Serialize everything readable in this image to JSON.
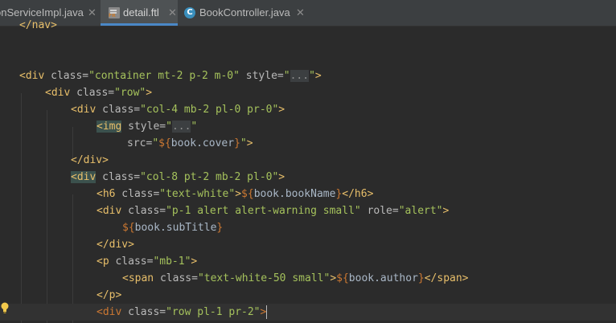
{
  "tabs": [
    {
      "label": "onServiceImpl.java",
      "active": false,
      "icon": "none"
    },
    {
      "label": "detail.ftl",
      "active": true,
      "icon": "ftl-file-icon"
    },
    {
      "label": "BookController.java",
      "active": false,
      "icon": "class-icon"
    }
  ],
  "close_glyph": "✕",
  "class_icon_letter": "C",
  "ftl_icon_letters": "FR",
  "editor": {
    "lines": [
      {
        "tokens": [
          {
            "t": "tag",
            "v": "</nav>"
          }
        ]
      },
      {
        "tokens": []
      },
      {
        "tokens": []
      },
      {
        "tokens": [
          {
            "t": "tag",
            "v": "<div"
          },
          {
            "t": "attr",
            "v": " class="
          },
          {
            "t": "str",
            "v": "\"container mt-2 p-2 m-0\""
          },
          {
            "t": "attr",
            "v": " style="
          },
          {
            "t": "str",
            "v": "\""
          },
          {
            "t": "fold",
            "v": "..."
          },
          {
            "t": "str",
            "v": "\""
          },
          {
            "t": "tag",
            "v": ">"
          }
        ]
      },
      {
        "tokens": [
          {
            "t": "tag",
            "v": "<div"
          },
          {
            "t": "attr",
            "v": " class="
          },
          {
            "t": "str",
            "v": "\"row\""
          },
          {
            "t": "tag",
            "v": ">"
          }
        ]
      },
      {
        "tokens": [
          {
            "t": "tag",
            "v": "<div"
          },
          {
            "t": "attr",
            "v": " class="
          },
          {
            "t": "str",
            "v": "\"col-4 mb-2 pl-0 pr-0\""
          },
          {
            "t": "tag",
            "v": ">"
          }
        ]
      },
      {
        "tokens": [
          {
            "t": "taghl",
            "v": "<img"
          },
          {
            "t": "attr",
            "v": " style="
          },
          {
            "t": "str",
            "v": "\""
          },
          {
            "t": "fold",
            "v": "..."
          },
          {
            "t": "str",
            "v": "\""
          }
        ]
      },
      {
        "tokens": [
          {
            "t": "attr",
            "v": "src="
          },
          {
            "t": "str",
            "v": "\""
          },
          {
            "t": "ftl",
            "v": "${"
          },
          {
            "t": "expr",
            "v": "book.cover"
          },
          {
            "t": "ftl",
            "v": "}"
          },
          {
            "t": "str",
            "v": "\""
          },
          {
            "t": "tag",
            "v": ">"
          }
        ]
      },
      {
        "tokens": [
          {
            "t": "tag",
            "v": "</div>"
          }
        ]
      },
      {
        "tokens": [
          {
            "t": "taghl",
            "v": "<div"
          },
          {
            "t": "attr",
            "v": " class="
          },
          {
            "t": "str",
            "v": "\"col-8 pt-2 mb-2 pl-0\""
          },
          {
            "t": "tag",
            "v": ">"
          }
        ]
      },
      {
        "tokens": [
          {
            "t": "tag",
            "v": "<h6"
          },
          {
            "t": "attr",
            "v": " class="
          },
          {
            "t": "str",
            "v": "\"text-white\""
          },
          {
            "t": "tag",
            "v": ">"
          },
          {
            "t": "ftl",
            "v": "${"
          },
          {
            "t": "expr",
            "v": "book.bookName"
          },
          {
            "t": "ftl",
            "v": "}"
          },
          {
            "t": "tag",
            "v": "</h6>"
          }
        ]
      },
      {
        "tokens": [
          {
            "t": "tag",
            "v": "<div"
          },
          {
            "t": "attr",
            "v": " class="
          },
          {
            "t": "str",
            "v": "\"p-1 alert alert-warning small\""
          },
          {
            "t": "attr",
            "v": " role="
          },
          {
            "t": "str",
            "v": "\"alert\""
          },
          {
            "t": "tag",
            "v": ">"
          }
        ]
      },
      {
        "tokens": [
          {
            "t": "ftl",
            "v": "${"
          },
          {
            "t": "expr",
            "v": "book.subTitle"
          },
          {
            "t": "ftl",
            "v": "}"
          }
        ]
      },
      {
        "tokens": [
          {
            "t": "tag",
            "v": "</div>"
          }
        ]
      },
      {
        "tokens": [
          {
            "t": "tag",
            "v": "<p"
          },
          {
            "t": "attr",
            "v": " class="
          },
          {
            "t": "str",
            "v": "\"mb-1\""
          },
          {
            "t": "tag",
            "v": ">"
          }
        ]
      },
      {
        "tokens": [
          {
            "t": "tag",
            "v": "<span"
          },
          {
            "t": "attr",
            "v": " class="
          },
          {
            "t": "str",
            "v": "\"text-white-50 small\""
          },
          {
            "t": "tag",
            "v": ">"
          },
          {
            "t": "ftl",
            "v": "${"
          },
          {
            "t": "expr",
            "v": "book.author"
          },
          {
            "t": "ftl",
            "v": "}"
          },
          {
            "t": "tag",
            "v": "</span>"
          }
        ]
      },
      {
        "tokens": [
          {
            "t": "tag",
            "v": "</p>"
          }
        ]
      },
      {
        "tokens": [
          {
            "t": "end",
            "v": "<div"
          },
          {
            "t": "attr",
            "v": " class="
          },
          {
            "t": "str",
            "v": "\"row pl-1 pr-2\""
          },
          {
            "t": "end",
            "v": ">"
          }
        ]
      }
    ]
  },
  "colors": {
    "background": "#2b2b2b",
    "tag": "#e8bf6a",
    "string": "#a5c25c",
    "attribute": "#bababa",
    "freemarker": "#cc7832",
    "tab_underline": "#4a88c7"
  }
}
